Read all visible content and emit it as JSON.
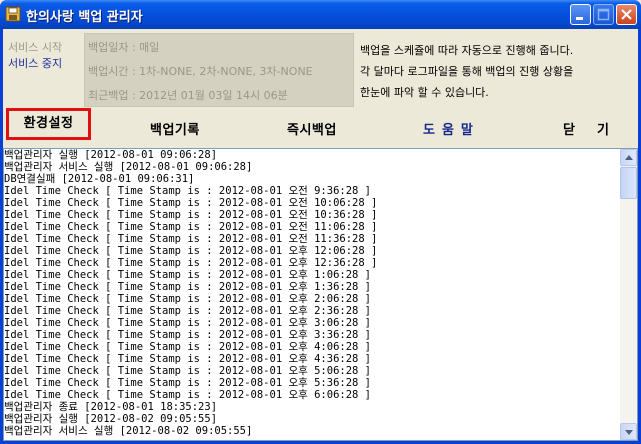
{
  "window": {
    "title": "한의사랑 백업 관리자",
    "icon": "floppy-disk-icon",
    "controls": [
      "minimize-icon",
      "maximize-icon",
      "close-icon"
    ]
  },
  "service": {
    "start_label": "서비스 시작",
    "stop_label": "서비스 중지"
  },
  "info": {
    "backup_date": "백업일자 : 매일",
    "backup_time": "백업시간 : 1차-NONE, 2차-NONE, 3차-NONE",
    "last_backup": "최근백업 : 2012년 01월 03일 14시 06분"
  },
  "description": {
    "line1": "백업을 스케쥴에 따라 자동으로 진행해 줍니다.",
    "line2": "각 달마다 로그파일을 통해 백업의 진행 상황을",
    "line3": "한눈에 파악 할 수 있습니다."
  },
  "toolbar": {
    "settings": "환경설정",
    "history": "백업기록",
    "immediate_backup": "즉시백업",
    "help": "도움말",
    "close": "닫기"
  },
  "log": [
    "백업관리자 실행 [2012-08-01 09:06:28]",
    "백업관리자 서비스 실행 [2012-08-01 09:06:28]",
    "DB연결실패 [2012-08-01 09:06:31]",
    "Idel Time Check [ Time Stamp is : 2012-08-01 오전 9:36:28 ]",
    "Idel Time Check [ Time Stamp is : 2012-08-01 오전 10:06:28 ]",
    "Idel Time Check [ Time Stamp is : 2012-08-01 오전 10:36:28 ]",
    "Idel Time Check [ Time Stamp is : 2012-08-01 오전 11:06:28 ]",
    "Idel Time Check [ Time Stamp is : 2012-08-01 오전 11:36:28 ]",
    "Idel Time Check [ Time Stamp is : 2012-08-01 오후 12:06:28 ]",
    "Idel Time Check [ Time Stamp is : 2012-08-01 오후 12:36:28 ]",
    "Idel Time Check [ Time Stamp is : 2012-08-01 오후 1:06:28 ]",
    "Idel Time Check [ Time Stamp is : 2012-08-01 오후 1:36:28 ]",
    "Idel Time Check [ Time Stamp is : 2012-08-01 오후 2:06:28 ]",
    "Idel Time Check [ Time Stamp is : 2012-08-01 오후 2:36:28 ]",
    "Idel Time Check [ Time Stamp is : 2012-08-01 오후 3:06:28 ]",
    "Idel Time Check [ Time Stamp is : 2012-08-01 오후 3:36:28 ]",
    "Idel Time Check [ Time Stamp is : 2012-08-01 오후 4:06:28 ]",
    "Idel Time Check [ Time Stamp is : 2012-08-01 오후 4:36:28 ]",
    "Idel Time Check [ Time Stamp is : 2012-08-01 오후 5:06:28 ]",
    "Idel Time Check [ Time Stamp is : 2012-08-01 오후 5:36:28 ]",
    "Idel Time Check [ Time Stamp is : 2012-08-01 오후 6:06:28 ]",
    "백업관리자 종료 [2012-08-01 18:35:23]",
    "백업관리자 실행 [2012-08-02 09:05:55]",
    "백업관리자 서비스 실행 [2012-08-02 09:05:55]"
  ],
  "colors": {
    "titlebar": "#0550de",
    "highlight_border": "#e01010",
    "help_text": "#15288e",
    "service_stop": "#1d2fa0"
  }
}
